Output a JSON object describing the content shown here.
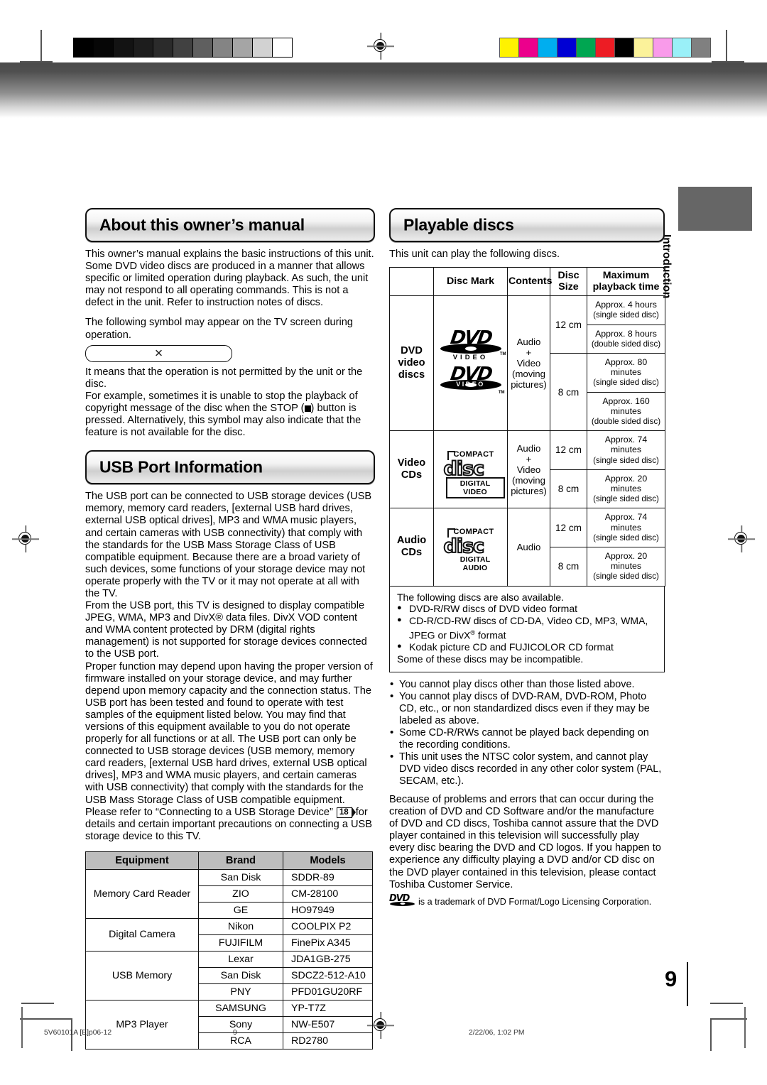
{
  "document": {
    "page_number": "9",
    "sidebar_tab": "Introduction",
    "footer": {
      "file_code": "5V60101A [E]p06-12",
      "page": "9",
      "timestamp": "2/22/06, 1:02 PM"
    }
  },
  "calibration": {
    "grayscale_patches": [
      "#000000",
      "#060606",
      "#131313",
      "#1d1d1d",
      "#2b2b2b",
      "#414141",
      "#5f5f5f",
      "#848484",
      "#a5a5a5",
      "#d2d2d2",
      "#ffffff"
    ],
    "color_patches": [
      "#fff200",
      "#ec008c",
      "#00aeef",
      "#0000d4",
      "#00a651",
      "#ed1c24",
      "#000000",
      "#fbf29a",
      "#f99bea",
      "#9af0f8",
      "#808080"
    ]
  },
  "about": {
    "heading": "About this owner’s manual",
    "p1": "This owner’s manual explains the basic instructions of this unit. Some DVD video discs are produced in a manner that allows specific or limited operation during playback. As such, the unit may not respond to all operating commands. This is not a defect in the unit. Refer to instruction notes of discs.",
    "p2": "The following symbol may appear on the TV screen during operation.",
    "symbol_glyph": "✕",
    "p3": "It means that the operation is not permitted by the unit or the disc.",
    "p4_a": "For example, sometimes it is unable to stop the playback of copyright message of the disc when the STOP (",
    "p4_b": ") button is pressed. Alternatively, this symbol may also indicate that the feature is not available for the disc."
  },
  "usb": {
    "heading": "USB Port Information",
    "p1": "The USB port can be connected to USB storage devices (USB memory, memory card readers, [external USB hard drives, external USB optical drives], MP3 and WMA music players, and certain cameras with USB connectivity) that comply with the standards for the USB Mass Storage Class of USB compatible equipment.  Because there are a broad variety of such devices, some functions of your storage device may not operate properly with the TV or it may not operate at all with the TV.",
    "p2": "From the USB port, this TV is designed to display compatible JPEG, WMA, MP3 and DivX® data files. DivX VOD content and WMA content protected by DRM (digital rights management) is not supported for storage devices connected to the USB port.",
    "p3": "Proper function may depend upon having the proper version of firmware installed on your storage device, and may further depend upon memory capacity and the connection status. The USB port has been tested and found to operate with test samples of the equipment listed below.  You may find that versions of this equipment available to you do not operate properly for all functions or at all. The USB port can only be connected to USB storage devices (USB memory, memory card readers, [external USB hard drives, external USB optical drives], MP3 and WMA music players, and certain cameras with USB connectivity) that comply with the standards for the USB Mass Storage Class of USB compatible equipment.",
    "p4_a": "Please refer to “Connecting to a USB Storage Device”",
    "p4_ref": "18",
    "p4_b": "for details and certain important precautions on connecting a USB storage device to this TV."
  },
  "equipment_table": {
    "headers": [
      "Equipment",
      "Brand",
      "Models"
    ],
    "groups": [
      {
        "equipment": "Memory Card Reader",
        "rows": [
          [
            "San Disk",
            "SDDR-89"
          ],
          [
            "ZIO",
            "CM-28100"
          ],
          [
            "GE",
            "HO97949"
          ]
        ]
      },
      {
        "equipment": "Digital Camera",
        "rows": [
          [
            "Nikon",
            "COOLPIX P2"
          ],
          [
            "FUJIFILM",
            "FinePix A345"
          ]
        ]
      },
      {
        "equipment": "USB Memory",
        "rows": [
          [
            "Lexar",
            "JDA1GB-275"
          ],
          [
            "San Disk",
            "SDCZ2-512-A10"
          ],
          [
            "PNY",
            "PFD01GU20RF"
          ]
        ]
      },
      {
        "equipment": "MP3 Player",
        "rows": [
          [
            "SAMSUNG",
            "YP-T7Z"
          ],
          [
            "Sony",
            "NW-E507"
          ],
          [
            "RCA",
            "RD2780"
          ]
        ]
      }
    ]
  },
  "playable": {
    "heading": "Playable discs",
    "intro": "This unit can play the following discs.",
    "headers": {
      "blank": "",
      "disc_mark": "Disc Mark",
      "contents": "Contents",
      "disc_size_l1": "Disc",
      "disc_size_l2": "Size",
      "max_time_l1": "Maximum",
      "max_time_l2": "playback time"
    },
    "rows": [
      {
        "type": "DVD video discs",
        "mark": "dvd-video-logo",
        "mark_text_1": "DVD",
        "mark_text_2": "VIDEO",
        "contents": "Audio + Video (moving pictures)",
        "sizes": [
          {
            "size": "12 cm",
            "times": [
              {
                "l1": "Approx. 4 hours",
                "l2": "(single sided disc)"
              },
              {
                "l1": "Approx. 8 hours",
                "l2": "(double sided disc)"
              }
            ]
          },
          {
            "size": "8 cm",
            "times": [
              {
                "l1": "Approx. 80 minutes",
                "l2": "(single sided disc)"
              },
              {
                "l1": "Approx. 160 minutes",
                "l2": "(double sided disc)"
              }
            ]
          }
        ]
      },
      {
        "type": "Video CDs",
        "mark": "compact-disc-digital-video-logo",
        "mark_text_1": "COMPACT",
        "mark_text_2": "disc",
        "mark_text_3": "DIGITAL VIDEO",
        "contents": "Audio + Video (moving pictures)",
        "sizes": [
          {
            "size": "12 cm",
            "times": [
              {
                "l1": "Approx. 74 minutes",
                "l2": "(single sided disc)"
              }
            ]
          },
          {
            "size": "8 cm",
            "times": [
              {
                "l1": "Approx. 20 minutes",
                "l2": "(single sided disc)"
              }
            ]
          }
        ]
      },
      {
        "type": "Audio CDs",
        "mark": "compact-disc-digital-audio-logo",
        "mark_text_1": "COMPACT",
        "mark_text_2": "disc",
        "mark_text_3": "DIGITAL AUDIO",
        "contents": "Audio",
        "sizes": [
          {
            "size": "12 cm",
            "times": [
              {
                "l1": "Approx. 74 minutes",
                "l2": "(single sided disc)"
              }
            ]
          },
          {
            "size": "8 cm",
            "times": [
              {
                "l1": "Approx. 20 minutes",
                "l2": "(single sided disc)"
              }
            ]
          }
        ]
      }
    ],
    "also_available": {
      "intro": "The following discs are also available.",
      "items": [
        "DVD-R/RW discs of DVD video format",
        "CD-R/CD-RW discs of CD-DA, Video CD, MP3, WMA, JPEG or DivX® format",
        "Kodak picture CD and FUJICOLOR CD format"
      ],
      "note": "Some of these discs may be incompatible."
    },
    "notes": [
      "You cannot play discs other than those listed above.",
      "You cannot play discs of DVD-RAM, DVD-ROM, Photo CD, etc., or non standardized discs even if they may be labeled as above.",
      "Some CD-R/RWs cannot be played back depending on the recording conditions.",
      "This unit uses the NTSC color system, and cannot play DVD video discs recorded in any other color system (PAL, SECAM, etc.)."
    ],
    "disclaimer": "Because of problems and errors that can occur during the creation of DVD and CD Software and/or the manufacture of DVD and CD discs, Toshiba cannot assure that the DVD player contained in this television will successfully play every disc bearing the DVD and CD logos.  If you happen to experience any difficulty playing a DVD and/or CD disc on the DVD player contained in this television, please contact Toshiba Customer Service.",
    "trademark": "is a trademark of DVD Format/Logo Licensing Corporation."
  }
}
